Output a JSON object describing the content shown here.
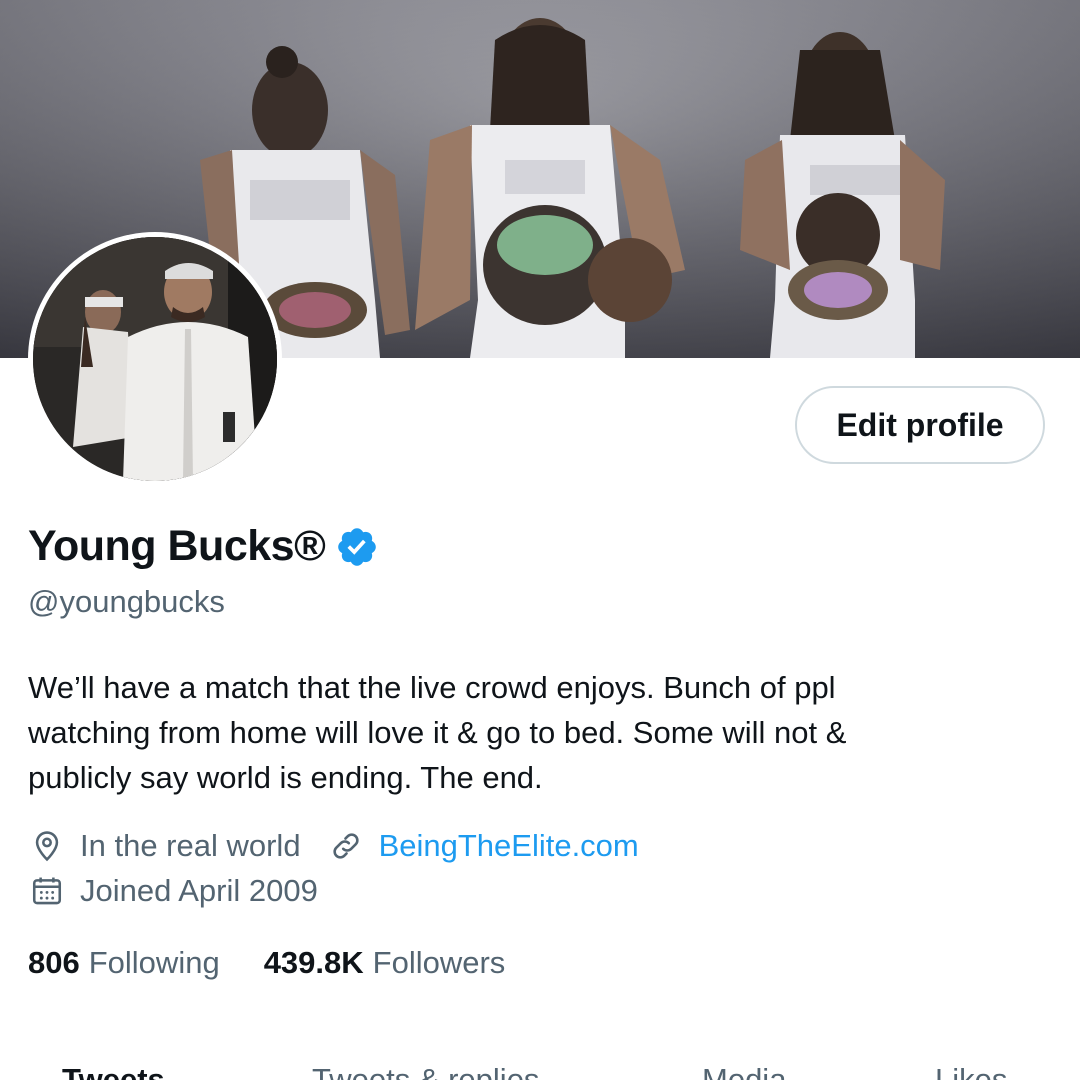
{
  "profile": {
    "display_name": "Young Bucks®",
    "handle": "@youngbucks",
    "bio": "We’ll have a match that the live crowd enjoys. Bunch of ppl\nwatching from home will love it & go to bed. Some will not &\npublicly say world is ending. The end.",
    "location": "In the real world",
    "website": "BeingTheElite.com",
    "joined": "Joined April 2009",
    "following_count": "806",
    "following_label": "Following",
    "followers_count": "439.8K",
    "followers_label": "Followers",
    "verified": true
  },
  "actions": {
    "edit_profile_label": "Edit profile"
  },
  "tabs": [
    {
      "label": "Tweets",
      "active": true
    },
    {
      "label": "Tweets & replies",
      "active": false
    },
    {
      "label": "Media",
      "active": false
    },
    {
      "label": "Likes",
      "active": false
    }
  ],
  "colors": {
    "accent": "#1d9bf0",
    "text_primary": "#0f1419",
    "text_secondary": "#536471",
    "border": "#cfd9de"
  },
  "icons": {
    "verified": "verified-badge-icon",
    "location": "location-pin-icon",
    "link": "link-icon",
    "calendar": "calendar-icon"
  }
}
